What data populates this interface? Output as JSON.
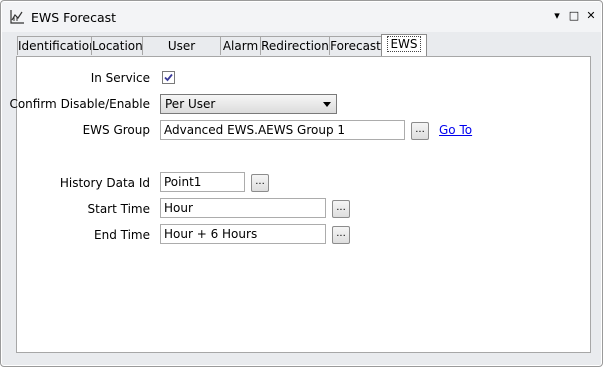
{
  "window": {
    "title": "EWS Forecast",
    "controls": {
      "menu": "▾",
      "maximize": "□",
      "close": "✕"
    }
  },
  "tabs": [
    {
      "label": "Identification"
    },
    {
      "label": "Location"
    },
    {
      "label": "User Methods"
    },
    {
      "label": "Alarm"
    },
    {
      "label": "Redirection"
    },
    {
      "label": "Forecast"
    },
    {
      "label": "EWS",
      "active": true
    }
  ],
  "form": {
    "in_service": {
      "label": "In Service",
      "checked": true
    },
    "confirm_disable": {
      "label": "Confirm Disable/Enable",
      "value": "Per User"
    },
    "ews_group": {
      "label": "EWS Group",
      "value": "Advanced EWS.AEWS Group 1",
      "button": "...",
      "link": "Go To"
    },
    "history_data_id": {
      "label": "History Data Id",
      "value": "Point1",
      "button": "..."
    },
    "start_time": {
      "label": "Start Time",
      "value": "Hour",
      "button": "..."
    },
    "end_time": {
      "label": "End Time",
      "value": "Hour + 6 Hours",
      "button": "..."
    }
  },
  "colors": {
    "link": "#0000ee",
    "check": "#3b3b9a"
  }
}
